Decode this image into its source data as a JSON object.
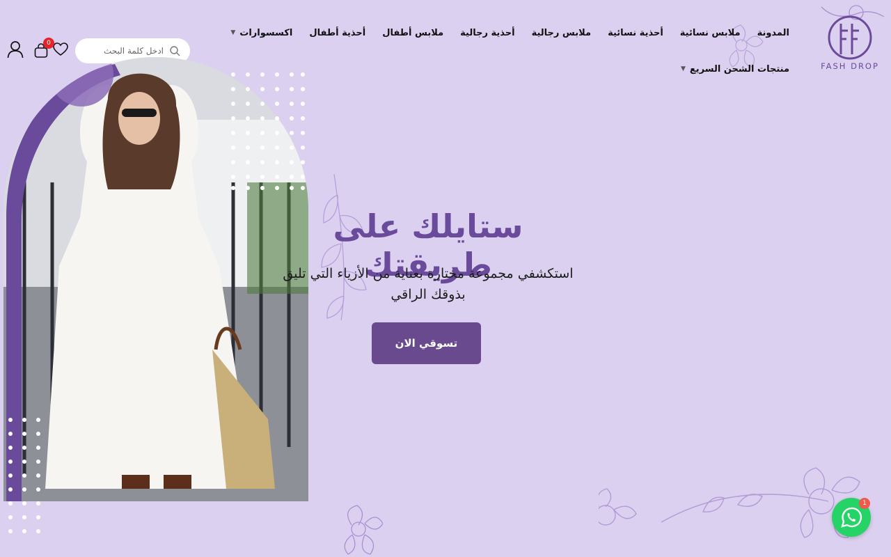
{
  "brand": {
    "logo_text": "FASH DROP"
  },
  "nav": {
    "row1": [
      {
        "label": "المدونة",
        "has_dropdown": false
      },
      {
        "label": "ملابس نسائية",
        "has_dropdown": false
      },
      {
        "label": "أحذية نسائية",
        "has_dropdown": false
      },
      {
        "label": "ملابس رجالية",
        "has_dropdown": false
      },
      {
        "label": "أحذية رجالية",
        "has_dropdown": false
      },
      {
        "label": "ملابس أطفال",
        "has_dropdown": false
      },
      {
        "label": "أحذية أطفال",
        "has_dropdown": false
      },
      {
        "label": "اكسسوارات",
        "has_dropdown": true
      }
    ],
    "row2": [
      {
        "label": "منتجات الشحن السريع",
        "has_dropdown": true
      }
    ]
  },
  "search": {
    "placeholder": "ادخل كلمة البحث"
  },
  "header_icons": {
    "cart_count": "0"
  },
  "hero": {
    "title": "ستايلك على طريقتك",
    "subtitle": "استكشفي مجموعة مختارة بعناية من الأزياء التي تليق بذوقك الراقي",
    "cta_label": "تسوقي الان"
  },
  "whatsapp": {
    "badge": "1"
  },
  "colors": {
    "background": "#dcd0f0",
    "accent": "#6a4a9a",
    "button": "#6a4a8e",
    "whatsapp": "#25d366"
  }
}
